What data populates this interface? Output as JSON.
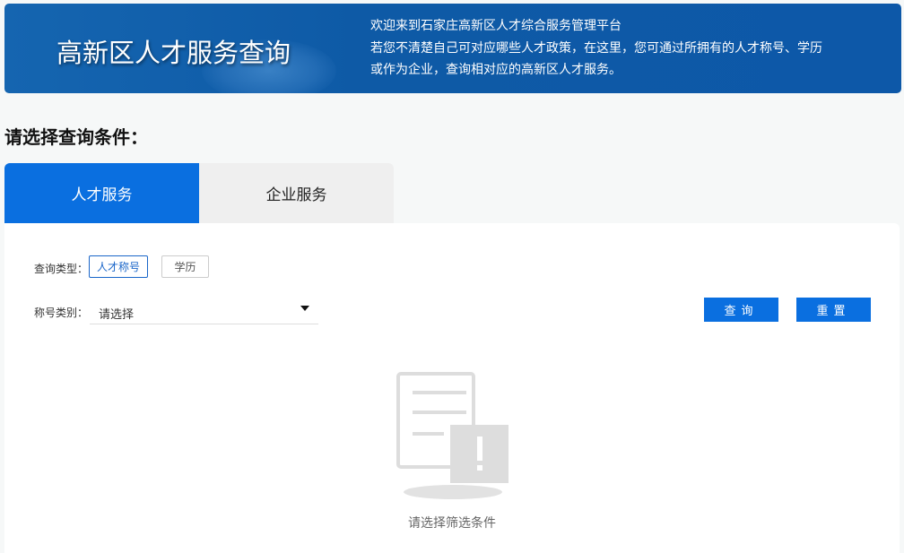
{
  "banner": {
    "title": "高新区人才服务查询",
    "lines": [
      "欢迎来到石家庄高新区人才综合服务管理平台",
      "若您不清楚自己可对应哪些人才政策，在这里，您可通过所拥有的人才称号、学历",
      "或作为企业，查询相对应的高新区人才服务。"
    ]
  },
  "heading": "请选择查询条件：",
  "tabs": [
    {
      "label": "人才服务"
    },
    {
      "label": "企业服务"
    }
  ],
  "form": {
    "type_label": "查询类型：",
    "type_options": [
      "人才称号",
      "学历"
    ],
    "category_label": "称号类别：",
    "category_placeholder": "请选择"
  },
  "buttons": {
    "query": "查询",
    "reset": "重置"
  },
  "empty": {
    "text": "请选择筛选条件"
  }
}
